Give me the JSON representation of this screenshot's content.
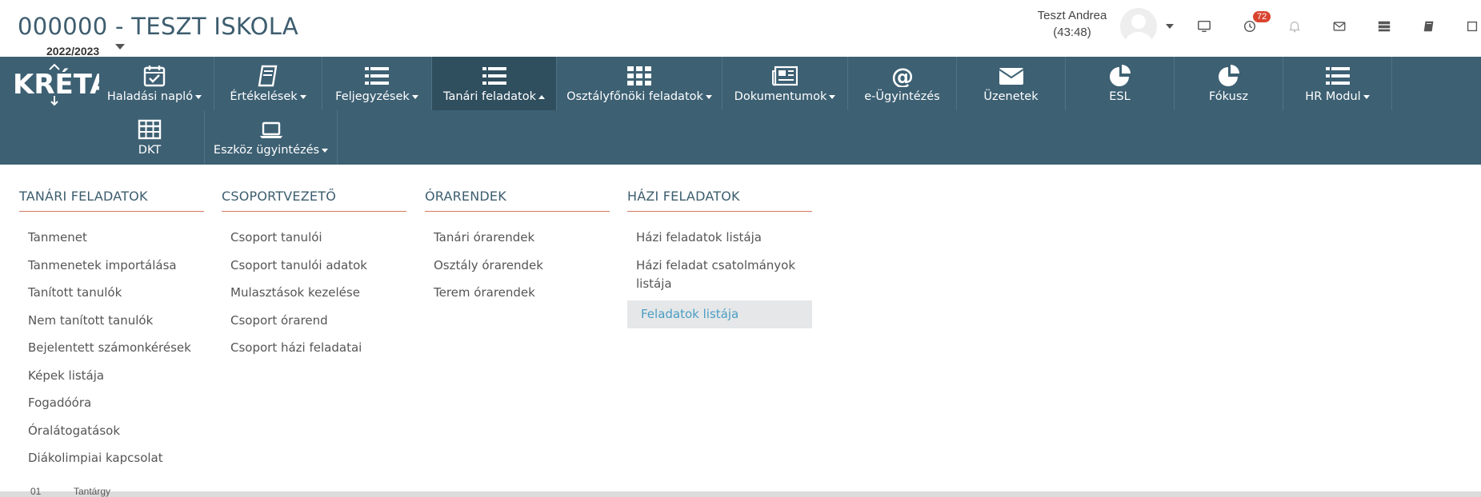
{
  "header": {
    "school_title": "000000 - TESZT ISKOLA",
    "school_year": "2022/2023",
    "user_name": "Teszt Andrea",
    "session_timer": "(43:48)",
    "notification_count": "72"
  },
  "nav": {
    "logo_text": "KRÉTA",
    "items": [
      {
        "label": "Haladási napló",
        "icon": "calendar-check-icon"
      },
      {
        "label": "Értékelések",
        "icon": "book-icon"
      },
      {
        "label": "Feljegyzések",
        "icon": "list-icon"
      },
      {
        "label": "Tanári feladatok",
        "icon": "list-icon"
      },
      {
        "label": "Osztályfőnöki feladatok",
        "icon": "grid-icon"
      },
      {
        "label": "Dokumentumok",
        "icon": "newspaper-icon"
      },
      {
        "label": "e-Ügyintézés",
        "icon": "at-icon"
      },
      {
        "label": "Üzenetek",
        "icon": "envelope-icon"
      },
      {
        "label": "ESL",
        "icon": "pie-chart-icon"
      },
      {
        "label": "Fókusz",
        "icon": "pie-chart-icon"
      },
      {
        "label": "HR Modul",
        "icon": "list-icon"
      },
      {
        "label": "DKT",
        "icon": "table-icon"
      },
      {
        "label": "Eszköz ügyintézés",
        "icon": "laptop-icon"
      }
    ]
  },
  "menu": {
    "columns": [
      {
        "title": "TANÁRI FELADATOK",
        "items": [
          "Tanmenet",
          "Tanmenetek importálása",
          "Tanított tanulók",
          "Nem tanított tanulók",
          "Bejelentett számonkérések",
          "Képek listája",
          "Fogadóóra",
          "Óralátogatások",
          "Diákolimpiai kapcsolat"
        ]
      },
      {
        "title": "CSOPORTVEZETŐ",
        "items": [
          "Csoport tanulói",
          "Csoport tanulói adatok",
          "Mulasztások kezelése",
          "Csoport órarend",
          "Csoport házi feladatai"
        ]
      },
      {
        "title": "ÓRARENDEK",
        "items": [
          "Tanári órarendek",
          "Osztály órarendek",
          "Terem órarendek"
        ]
      },
      {
        "title": "HÁZI FELADATOK",
        "items": [
          "Házi feladatok listája",
          "Házi feladat csatolmányok listája",
          "Feladatok listája"
        ]
      }
    ]
  },
  "background": {
    "row_number": "01",
    "row_label": "Tantárgy"
  },
  "colors": {
    "nav_bg": "#3d6073",
    "nav_active_bg": "#2f4e5e",
    "column_underline": "#d47a63",
    "selected_link": "#4a9dc4",
    "badge": "#d9442f"
  }
}
